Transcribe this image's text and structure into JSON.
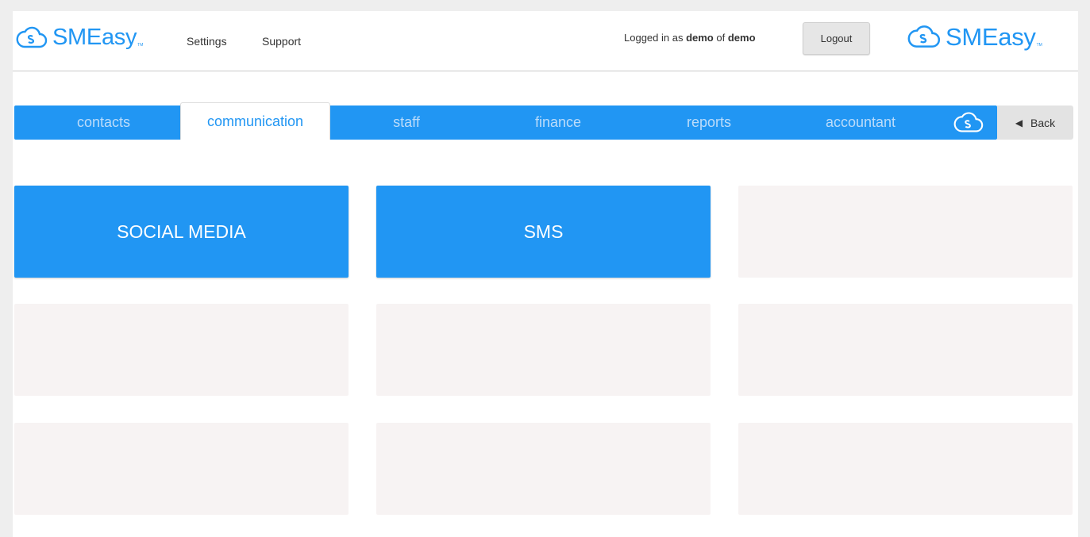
{
  "header": {
    "brand": "SMEasy",
    "brand_tm": "TM",
    "nav": {
      "settings": "Settings",
      "support": "Support"
    },
    "login": {
      "prefix": "Logged in as",
      "user": "demo",
      "of": "of",
      "org": "demo"
    },
    "logout_label": "Logout"
  },
  "tabs": [
    {
      "label": "contacts",
      "active": false
    },
    {
      "label": "communication",
      "active": true
    },
    {
      "label": "staff",
      "active": false
    },
    {
      "label": "finance",
      "active": false
    },
    {
      "label": "reports",
      "active": false
    },
    {
      "label": "accountant",
      "active": false
    }
  ],
  "back_label": "Back",
  "tiles": {
    "social_media": "SOCIAL MEDIA",
    "sms": "SMS"
  },
  "icons": {
    "brand_logo": "cloud-s-icon",
    "back_arrow": "triangle-left-icon"
  },
  "colors": {
    "accent": "#2196f3",
    "inactive_tab_text": "#bcdcfa",
    "empty_tile": "#f7f3f3"
  }
}
